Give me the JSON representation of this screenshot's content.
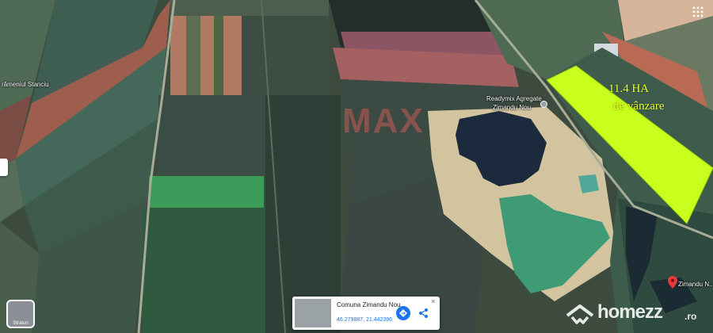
{
  "map": {
    "place_label_left": "rămeniul Stanciu",
    "poi_label_line1": "Readymix Agregate",
    "poi_label_line2": "Zimandu Nou",
    "pin_label": "Zimandu N...",
    "plot_area": "11.4 HA",
    "plot_note": "de vânzare",
    "watermark_text": "MAX"
  },
  "place_card": {
    "title": "Comuna Zimandu Nou",
    "coordinates": "46.279887, 21.442396",
    "close": "×"
  },
  "layers_button": {
    "label": "Straturi"
  },
  "branding": {
    "name": "homezz",
    "tld": ".ro"
  },
  "colors": {
    "plot": "#c9ff1c",
    "label_yellow": "#e9ff22",
    "pin": "#e23b3b",
    "button_blue": "#1a73e8"
  },
  "icons": [
    "apps-grid-icon",
    "directions-icon",
    "share-icon",
    "close-icon",
    "map-pin-icon",
    "poi-pin-icon",
    "home-logo-icon"
  ]
}
